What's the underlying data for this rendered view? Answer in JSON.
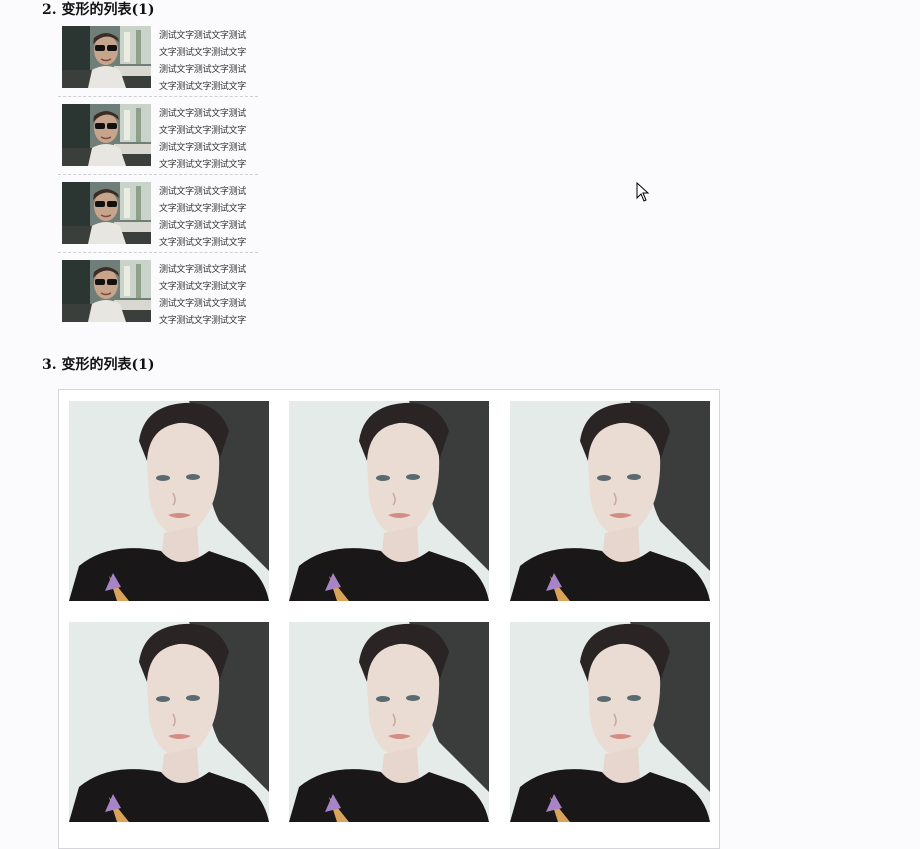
{
  "section2": {
    "title": "2. 变形的列表(1)",
    "items": [
      {
        "text": "测试文字测试文字测试文字测试文字测试文字测试文字测试文字测试文字测试文字测试文字"
      },
      {
        "text": "测试文字测试文字测试文字测试文字测试文字测试文字测试文字测试文字测试文字测试文字"
      },
      {
        "text": "测试文字测试文字测试文字测试文字测试文字测试文字测试文字测试文字测试文字测试文字"
      },
      {
        "text": "测试文字测试文字测试文字测试文字测试文字测试文字测试文字测试文字测试文字测试文字"
      }
    ]
  },
  "section3": {
    "title": "3. 变形的列表(1)",
    "tile_count": 6
  },
  "colors": {
    "background": "#fbfbfd",
    "separator": "#cfcfd4",
    "grid_border": "#d6d6da"
  }
}
